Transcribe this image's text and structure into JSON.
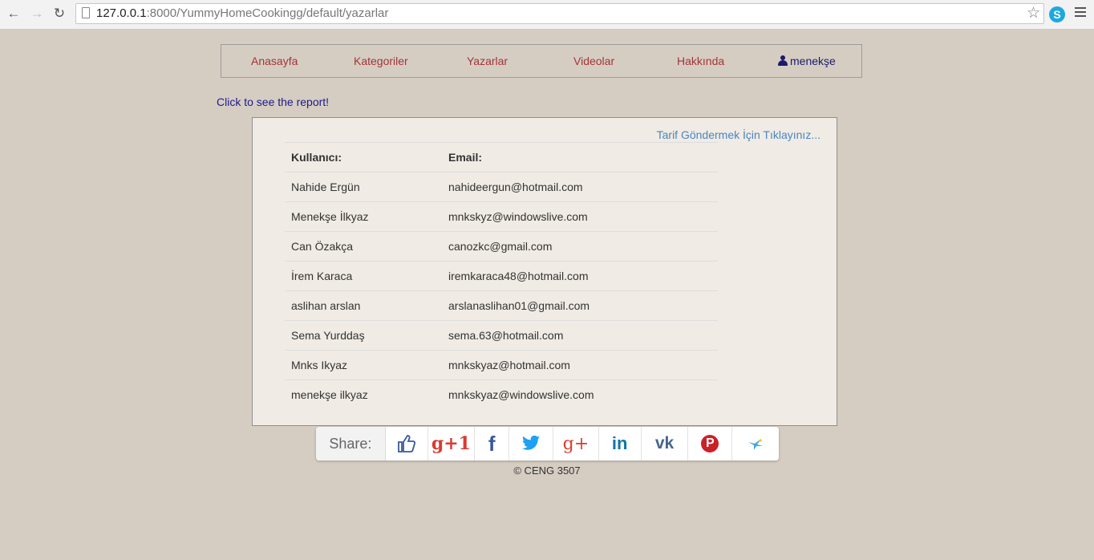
{
  "browser": {
    "url_host": "127.0.0.1",
    "url_rest": ":8000/YummyHomeCookingg/default/yazarlar"
  },
  "nav": {
    "items": [
      "Anasayfa",
      "Kategoriler",
      "Yazarlar",
      "Videolar",
      "Hakkında"
    ],
    "user": "menekşe",
    "link_color": "#a2343a",
    "user_color": "#1b1a6e"
  },
  "report_link": "Click to see the report!",
  "tarif_link": "Tarif Göndermek İçin Tıklayınız...",
  "table": {
    "headers": [
      "Kullanıcı:",
      "Email:"
    ],
    "rows": [
      [
        "Nahide Ergün",
        "nahideergun@hotmail.com"
      ],
      [
        "Menekşe İlkyaz",
        "mnkskyz@windowslive.com"
      ],
      [
        "Can Özakça",
        "canozkc@gmail.com"
      ],
      [
        "İrem Karaca",
        "iremkaraca48@hotmail.com"
      ],
      [
        "aslihan arslan",
        "arslanaslihan01@gmail.com"
      ],
      [
        "Sema Yurddaş",
        "sema.63@hotmail.com"
      ],
      [
        "Mnks Ikyaz",
        "mnkskyaz@hotmail.com"
      ],
      [
        "menekşe ilkyaz",
        "mnkskyaz@windowslive.com"
      ]
    ]
  },
  "share": {
    "label": "Share:",
    "buttons": [
      {
        "name": "like",
        "icon": "thumbs-up-icon"
      },
      {
        "name": "google-plus-one",
        "icon": "gplus-one-icon",
        "text": "g+1"
      },
      {
        "name": "facebook",
        "icon": "facebook-icon",
        "text": "f"
      },
      {
        "name": "twitter",
        "icon": "twitter-icon"
      },
      {
        "name": "google-plus",
        "icon": "gplus-icon",
        "text": "g+"
      },
      {
        "name": "linkedin",
        "icon": "linkedin-icon",
        "text": "in"
      },
      {
        "name": "vk",
        "icon": "vk-icon",
        "text": "vk"
      },
      {
        "name": "pinterest",
        "icon": "pinterest-icon",
        "text": "P"
      },
      {
        "name": "more",
        "icon": "hummingbird-icon"
      }
    ]
  },
  "footer": "© CENG 3507"
}
